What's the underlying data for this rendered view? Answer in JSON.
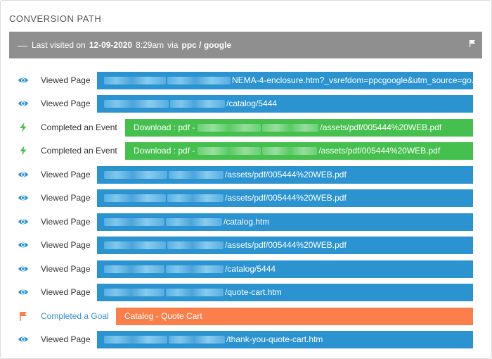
{
  "panel": {
    "title": "CONVERSION PATH"
  },
  "visit": {
    "prefix": "Last visited on",
    "date": "12-09-2020",
    "time": "8:29am",
    "via": "via",
    "source": "ppc / google",
    "collapse_icon": "minus-icon",
    "flag_icon": "flag-icon"
  },
  "colors": {
    "page": "#2b93d0",
    "event": "#45c04e",
    "goal": "#fa7f4a",
    "visit_bar": "#8f8f8f"
  },
  "rows": [
    {
      "kind": "page",
      "label": "Viewed Page",
      "icon": "eye-icon",
      "text": "NEMA-4-enclosure.htm?_vsrefdom=ppcgoogle&utm_source=go..."
    },
    {
      "kind": "page",
      "label": "Viewed Page",
      "icon": "eye-icon",
      "text": "/catalog/5444"
    },
    {
      "kind": "event",
      "label": "Completed an Event",
      "icon": "bolt-icon",
      "text_prefix": "Download : pdf -",
      "text": "/assets/pdf/005444%20WEB.pdf"
    },
    {
      "kind": "event",
      "label": "Completed an Event",
      "icon": "bolt-icon",
      "text_prefix": "Download : pdf -",
      "text": "/assets/pdf/005444%20WEB.pdf"
    },
    {
      "kind": "page",
      "label": "Viewed Page",
      "icon": "eye-icon",
      "text": "/assets/pdf/005444%20WEB.pdf"
    },
    {
      "kind": "page",
      "label": "Viewed Page",
      "icon": "eye-icon",
      "text": "/assets/pdf/005444%20WEB.pdf"
    },
    {
      "kind": "page",
      "label": "Viewed Page",
      "icon": "eye-icon",
      "text": "/catalog.htm"
    },
    {
      "kind": "page",
      "label": "Viewed Page",
      "icon": "eye-icon",
      "text": "/assets/pdf/005444%20WEB.pdf"
    },
    {
      "kind": "page",
      "label": "Viewed Page",
      "icon": "eye-icon",
      "text": "/catalog/5444"
    },
    {
      "kind": "page",
      "label": "Viewed Page",
      "icon": "eye-icon",
      "text": "/quote-cart.htm"
    },
    {
      "kind": "goal",
      "label": "Completed a Goal",
      "icon": "flag-icon",
      "text": "Catalog - Quote Cart"
    },
    {
      "kind": "page",
      "label": "Viewed Page",
      "icon": "eye-icon",
      "text": "/thank-you-quote-cart.htm"
    }
  ]
}
